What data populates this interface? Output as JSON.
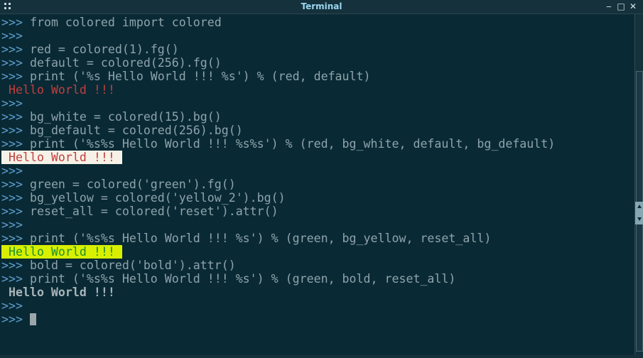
{
  "window": {
    "title": "Terminal",
    "controls": {
      "minimize": "‒",
      "maximize": "□",
      "close": "✕"
    }
  },
  "terminal": {
    "prompt": ">>>",
    "lines": [
      {
        "prompt": true,
        "text": " from colored import colored",
        "style": ""
      },
      {
        "prompt": true,
        "text": "",
        "style": ""
      },
      {
        "prompt": true,
        "text": " red = colored(1).fg()",
        "style": ""
      },
      {
        "prompt": true,
        "text": " default = colored(256).fg()",
        "style": ""
      },
      {
        "prompt": true,
        "text": " print ('%s Hello World !!! %s') % (red, default)",
        "style": ""
      },
      {
        "prompt": false,
        "text": " Hello World !!!",
        "style": "out-red"
      },
      {
        "prompt": true,
        "text": "",
        "style": ""
      },
      {
        "prompt": true,
        "text": " bg_white = colored(15).bg()",
        "style": ""
      },
      {
        "prompt": true,
        "text": " bg_default = colored(256).bg()",
        "style": ""
      },
      {
        "prompt": true,
        "text": " print ('%s%s Hello World !!! %s%s') % (red, bg_white, default, bg_default)",
        "style": ""
      },
      {
        "prompt": false,
        "text": " Hello World !!! ",
        "style": "out-redbg"
      },
      {
        "prompt": true,
        "text": "",
        "style": ""
      },
      {
        "prompt": true,
        "text": " green = colored('green').fg()",
        "style": ""
      },
      {
        "prompt": true,
        "text": " bg_yellow = colored('yellow_2').bg()",
        "style": ""
      },
      {
        "prompt": true,
        "text": " reset_all = colored('reset').attr()",
        "style": ""
      },
      {
        "prompt": true,
        "text": "",
        "style": ""
      },
      {
        "prompt": true,
        "text": " print ('%s%s Hello World !!! %s') % (green, bg_yellow, reset_all)",
        "style": ""
      },
      {
        "prompt": false,
        "text": " Hello World !!! ",
        "style": "out-green"
      },
      {
        "prompt": true,
        "text": " bold = colored('bold').attr()",
        "style": ""
      },
      {
        "prompt": true,
        "text": " print ('%s%s Hello World !!! %s') % (green, bold, reset_all)",
        "style": ""
      },
      {
        "prompt": false,
        "text": " Hello World !!!",
        "style": "out-bold"
      },
      {
        "prompt": true,
        "text": "",
        "style": ""
      },
      {
        "prompt": true,
        "text": " ",
        "style": "",
        "cursor": true
      }
    ]
  },
  "colors": {
    "background": "#092a35",
    "prompt": "#5f9fcf",
    "code": "#8fa3ab",
    "red": "#c33d3d",
    "green": "#1f8f2f",
    "yellow_bg": "#d8f000",
    "white_bg": "#f6f2e8"
  },
  "icons": {
    "menu": "window-menu-icon",
    "scroll_grip": "scroll-grip-icon"
  }
}
